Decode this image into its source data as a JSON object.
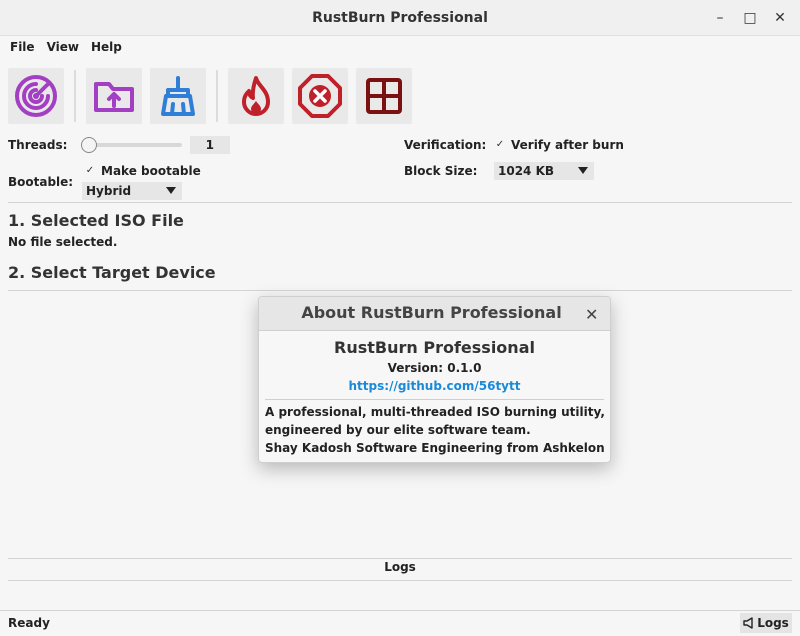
{
  "window": {
    "title": "RustBurn Professional",
    "controls": {
      "minimize": "–",
      "maximize": "□",
      "close": "✕"
    }
  },
  "menu": [
    "File",
    "View",
    "Help"
  ],
  "toolbar": {
    "buttons": [
      {
        "icon": "radar-icon",
        "color": "#a33fc2"
      },
      {
        "icon": "folder-upload-icon",
        "color": "#a33fc2"
      },
      {
        "icon": "broom-icon",
        "color": "#2f7fd8"
      },
      {
        "icon": "flame-icon",
        "color": "#c0202a"
      },
      {
        "icon": "stop-octagon-icon",
        "color": "#c0202a"
      },
      {
        "icon": "grid-icon",
        "color": "#7a1010"
      }
    ]
  },
  "settings": {
    "threads_label": "Threads:",
    "threads_value": "1",
    "threads_slider_fraction": 0,
    "bootable_label": "Bootable:",
    "make_bootable_label": "Make bootable",
    "make_bootable_checked": true,
    "boot_mode": "Hybrid",
    "verification_label": "Verification:",
    "verify_after_burn_label": "Verify after burn",
    "verify_checked": true,
    "block_size_label": "Block Size:",
    "block_size": "1024 KB"
  },
  "sections": {
    "iso_title": "1. Selected ISO File",
    "iso_status": "No file selected.",
    "device_title": "2. Select Target Device"
  },
  "logs": {
    "label": "Logs",
    "button_label": "Logs"
  },
  "status_bar": {
    "text": "Ready"
  },
  "about_dialog": {
    "title": "About RustBurn Professional",
    "close": "✕",
    "app_name": "RustBurn Professional",
    "version": "Version: 0.1.0",
    "link": "https://github.com/56tytt",
    "description": [
      "A professional, multi-threaded ISO burning utility,",
      "engineered by our elite software team.",
      "Shay Kadosh Software Engineering from Ashkelon"
    ]
  },
  "colors": {
    "accent_link": "#1a8ad8",
    "purple": "#a33fc2",
    "blue": "#2f7fd8",
    "red": "#c0202a"
  }
}
